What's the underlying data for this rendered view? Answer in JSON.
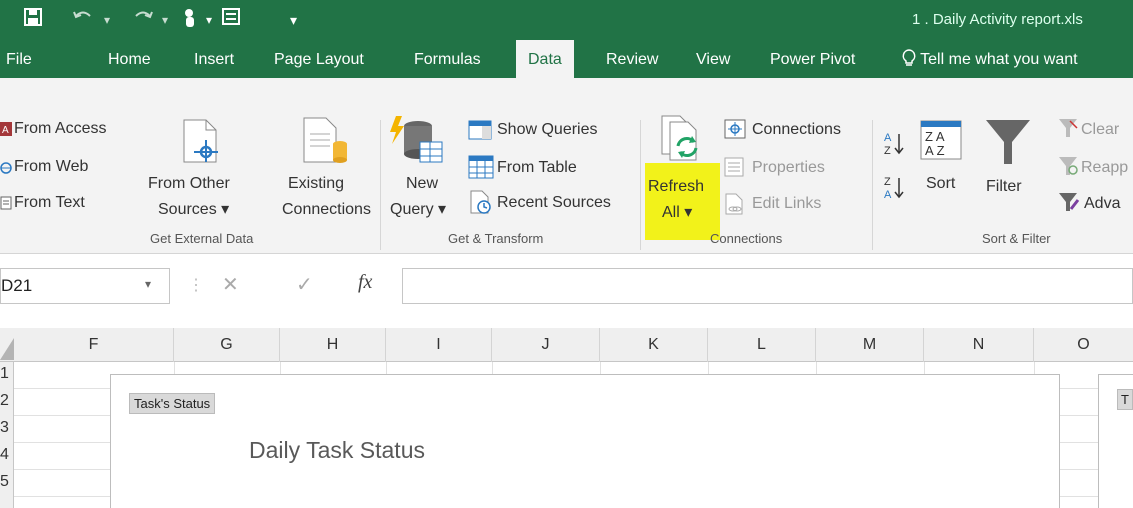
{
  "window": {
    "title": "1 . Daily Activity report.xls"
  },
  "qat": {
    "dropdown_glyph": "▾"
  },
  "tabs": [
    {
      "label": "File"
    },
    {
      "label": "Home"
    },
    {
      "label": "Insert"
    },
    {
      "label": "Page Layout"
    },
    {
      "label": "Formulas"
    },
    {
      "label": "Data"
    },
    {
      "label": "Review"
    },
    {
      "label": "View"
    },
    {
      "label": "Power Pivot"
    }
  ],
  "tell_me": {
    "label": "Tell me what you want"
  },
  "ribbon": {
    "get_external": {
      "from_access": "From Access",
      "from_web": "From Web",
      "from_text": "From Text",
      "from_other_1": "From Other",
      "from_other_2": "Sources ▾",
      "existing_1": "Existing",
      "existing_2": "Connections",
      "group_label": "Get External Data"
    },
    "get_transform": {
      "new_query_1": "New",
      "new_query_2": "Query ▾",
      "show_queries": "Show Queries",
      "from_table": "From Table",
      "recent_sources": "Recent Sources",
      "group_label": "Get & Transform"
    },
    "connections": {
      "refresh_1": "Refresh",
      "refresh_2": "All ▾",
      "connections": "Connections",
      "properties": "Properties",
      "edit_links": "Edit Links",
      "group_label": "Connections"
    },
    "sort_filter": {
      "sort": "Sort",
      "filter": "Filter",
      "clear": "Clear",
      "reapply": "Reapp",
      "advanced": "Adva",
      "group_label": "Sort & Filter"
    }
  },
  "formula_bar": {
    "name_box": "D21",
    "cancel": "✕",
    "enter": "✓",
    "fx": "fx",
    "value": ""
  },
  "columns": [
    "F",
    "G",
    "H",
    "I",
    "J",
    "K",
    "L",
    "M",
    "N",
    "O"
  ],
  "rows": [
    "1",
    "2",
    "3",
    "4",
    "5"
  ],
  "chart": {
    "tag": "Task's Status",
    "title": "Daily Task Status"
  },
  "chart2": {
    "tag": "T"
  },
  "colors": {
    "accent": "#217346",
    "highlight": "#f2f21a"
  }
}
